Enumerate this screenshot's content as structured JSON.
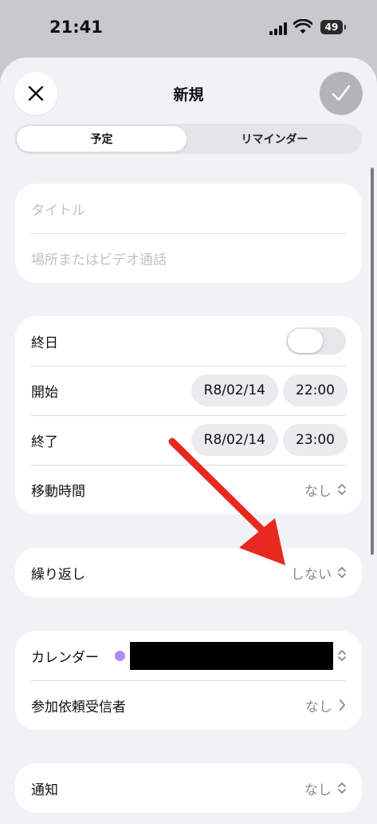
{
  "status_bar": {
    "time": "21:41",
    "battery": "49"
  },
  "header": {
    "title": "新規"
  },
  "segments": {
    "active": "予定",
    "inactive": "リマインダー"
  },
  "title_card": {
    "title_placeholder": "タイトル",
    "location_placeholder": "場所またはビデオ通話"
  },
  "date_card": {
    "all_day_label": "終日",
    "all_day_on": false,
    "start_label": "開始",
    "start_date": "R8/02/14",
    "start_time": "22:00",
    "end_label": "終了",
    "end_date": "R8/02/14",
    "end_time": "23:00",
    "travel_label": "移動時間",
    "travel_value": "なし"
  },
  "repeat_card": {
    "label": "繰り返し",
    "value": "しない"
  },
  "calendar_card": {
    "calendar_label": "カレンダー",
    "invitees_label": "参加依頼受信者",
    "invitees_value": "なし"
  },
  "alert_card": {
    "label": "通知",
    "value": "なし"
  },
  "colors": {
    "calendar_dot": "#b08cf2",
    "annotation_arrow": "#e8291f"
  }
}
